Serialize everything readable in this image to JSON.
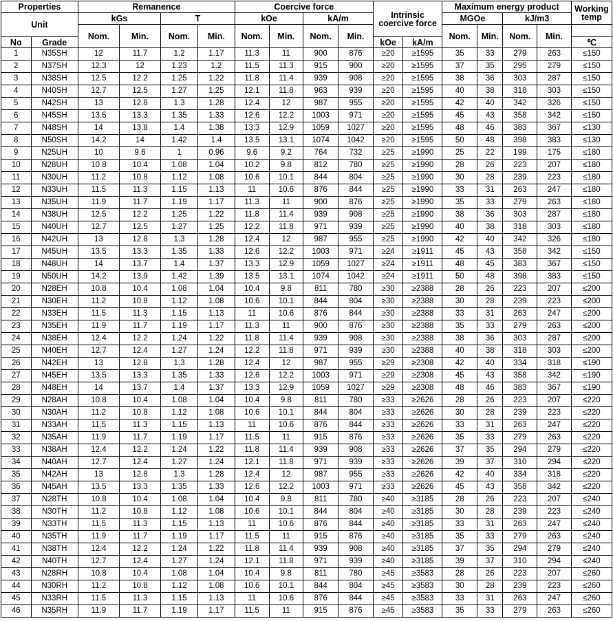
{
  "headers": {
    "properties": "Properties",
    "unit": "Unit",
    "no": "No",
    "grade": "Grade",
    "remanence": "Remanence",
    "coercive_force": "Coercive force",
    "intrinsic_coercive_force": "Intrinsic coercive force",
    "max_energy_product": "Maximum energy product",
    "working_temp": "Working temp",
    "kgs": "kGs",
    "t": "T",
    "koe": "kOe",
    "ka_m": "kA/m",
    "mgoe": "MGOe",
    "kj_m3": "kJ/m3",
    "nom": "Nom.",
    "min": "Min.",
    "celsius": "℃"
  },
  "rows": [
    [
      "1",
      "N35SH",
      "12",
      "11.7",
      "1.2",
      "1.17",
      "11.3",
      "11",
      "900",
      "876",
      "≥20",
      "≥1595",
      "35",
      "33",
      "279",
      "263",
      "≤150"
    ],
    [
      "2",
      "N37SH",
      "12.3",
      "12",
      "1.23",
      "1.2",
      "11.5",
      "11.3",
      "915",
      "900",
      "≥20",
      "≥1595",
      "37",
      "35",
      "295",
      "279",
      "≤150"
    ],
    [
      "3",
      "N38SH",
      "12.5",
      "12.2",
      "1.25",
      "1.22",
      "11.8",
      "11.4",
      "939",
      "908",
      "≥20",
      "≥1595",
      "38",
      "36",
      "303",
      "287",
      "≤150"
    ],
    [
      "4",
      "N40SH",
      "12.7",
      "12.5",
      "1.27",
      "1.25",
      "12.1",
      "11.8",
      "963",
      "939",
      "≥20",
      "≥1595",
      "40",
      "38",
      "318",
      "303",
      "≤150"
    ],
    [
      "5",
      "N42SH",
      "13",
      "12.8",
      "1.3",
      "1.28",
      "12.4",
      "12",
      "987",
      "955",
      "≥20",
      "≥1595",
      "42",
      "40",
      "342",
      "326",
      "≤150"
    ],
    [
      "6",
      "N45SH",
      "13.5",
      "13.3",
      "1.35",
      "1.33",
      "12.6",
      "12.2",
      "1003",
      "971",
      "≥20",
      "≥1595",
      "45",
      "43",
      "358",
      "342",
      "≤150"
    ],
    [
      "7",
      "N48SH",
      "14",
      "13.8",
      "1.4",
      "1.38",
      "13.3",
      "12.9",
      "1059",
      "1027",
      "≥20",
      "≥1595",
      "48",
      "46",
      "383",
      "367",
      "≤130"
    ],
    [
      "8",
      "N50SH",
      "14.2",
      "14",
      "1.42",
      "1.4",
      "13.5",
      "13.1",
      "1074",
      "1042",
      "≥20",
      "≥1595",
      "50",
      "48",
      "398",
      "383",
      "≤130"
    ],
    [
      "9",
      "N25UH",
      "10",
      "9.6",
      "1",
      "0.96",
      "9.6",
      "9.2",
      "764",
      "732",
      "≥25",
      "≥1990",
      "25",
      "22",
      "199",
      "175",
      "≤180"
    ],
    [
      "10",
      "N28UH",
      "10.8",
      "10.4",
      "1.08",
      "1.04",
      "10.2",
      "9.8",
      "812",
      "780",
      "≥25",
      "≥1990",
      "28",
      "26",
      "223",
      "207",
      "≤180"
    ],
    [
      "11",
      "N30UH",
      "11.2",
      "10.8",
      "1.12",
      "1.08",
      "10.6",
      "10.1",
      "844",
      "804",
      "≥25",
      "≥1990",
      "30",
      "28",
      "239",
      "223",
      "≤180"
    ],
    [
      "12",
      "N33UH",
      "11.5",
      "11.3",
      "1.15",
      "1.13",
      "11",
      "10.6",
      "876",
      "844",
      "≥25",
      "≥1990",
      "33",
      "31",
      "263",
      "247",
      "≤180"
    ],
    [
      "13",
      "N35UH",
      "11.9",
      "11.7",
      "1.19",
      "1.17",
      "11.3",
      "11",
      "900",
      "876",
      "≥25",
      "≥1990",
      "35",
      "33",
      "279",
      "263",
      "≤180"
    ],
    [
      "14",
      "N38UH",
      "12.5",
      "12.2",
      "1.25",
      "1.22",
      "11.8",
      "11.4",
      "939",
      "908",
      "≥25",
      "≥1990",
      "38",
      "36",
      "303",
      "287",
      "≤180"
    ],
    [
      "15",
      "N40UH",
      "12.7",
      "12.5",
      "1.27",
      "1.25",
      "12.2",
      "11.8",
      "971",
      "939",
      "≥25",
      "≥1990",
      "40",
      "38",
      "318",
      "303",
      "≤180"
    ],
    [
      "16",
      "N42UH",
      "13",
      "12.8",
      "1.3",
      "1.28",
      "12.4",
      "12",
      "987",
      "955",
      "≥25",
      "≥1990",
      "42",
      "40",
      "342",
      "326",
      "≤180"
    ],
    [
      "17",
      "N45UH",
      "13.5",
      "13.3",
      "1.35",
      "1.33",
      "12.6",
      "12.2",
      "1003",
      "971",
      "≥24",
      "≥1911",
      "45",
      "43",
      "358",
      "342",
      "≤150"
    ],
    [
      "18",
      "N48UH",
      "14",
      "13.7",
      "1.4",
      "1.37",
      "13.3",
      "12.9",
      "1059",
      "1027",
      "≥24",
      "≥1911",
      "48",
      "45",
      "383",
      "367",
      "≤150"
    ],
    [
      "19",
      "N50UH",
      "14.2",
      "13.9",
      "1.42",
      "1.39",
      "13.5",
      "13.1",
      "1074",
      "1042",
      "≥24",
      "≥1911",
      "50",
      "48",
      "398",
      "383",
      "≤150"
    ],
    [
      "20",
      "N28EH",
      "10.8",
      "10.4",
      "1.08",
      "1.04",
      "10.4",
      "9.8",
      "811",
      "780",
      "≥30",
      "≥2388",
      "28",
      "26",
      "223",
      "207",
      "≤200"
    ],
    [
      "21",
      "N30EH",
      "11.2",
      "10.8",
      "1.12",
      "1.08",
      "10.6",
      "10.1",
      "844",
      "804",
      "≥30",
      "≥2388",
      "30",
      "28",
      "239",
      "223",
      "≤200"
    ],
    [
      "22",
      "N33EH",
      "11.5",
      "11.3",
      "1.15",
      "1.13",
      "11",
      "10.6",
      "876",
      "844",
      "≥30",
      "≥2388",
      "33",
      "31",
      "263",
      "247",
      "≤200"
    ],
    [
      "23",
      "N35EH",
      "11.9",
      "11.7",
      "1.19",
      "1.17",
      "11.3",
      "11",
      "900",
      "876",
      "≥30",
      "≥2388",
      "35",
      "33",
      "279",
      "263",
      "≤200"
    ],
    [
      "24",
      "N38EH",
      "12.4",
      "12.2",
      "1.24",
      "1.22",
      "11.8",
      "11.4",
      "939",
      "908",
      "≥30",
      "≥2388",
      "38",
      "36",
      "303",
      "287",
      "≤200"
    ],
    [
      "25",
      "N40EH",
      "12.7",
      "12.4",
      "1.27",
      "1.24",
      "12.2",
      "11.8",
      "971",
      "939",
      "≥30",
      "≥2388",
      "40",
      "38",
      "318",
      "303",
      "≤200"
    ],
    [
      "26",
      "N42EH",
      "13",
      "12.8",
      "1.3",
      "1.28",
      "12.4",
      "12",
      "987",
      "955",
      "≥29",
      "≥2308",
      "42",
      "40",
      "334",
      "318",
      "≤190"
    ],
    [
      "27",
      "N45EH",
      "13.5",
      "13.3",
      "1.35",
      "1.33",
      "12.6",
      "12.2",
      "1003",
      "971",
      "≥29",
      "≥2308",
      "45",
      "43",
      "358",
      "342",
      "≤190"
    ],
    [
      "28",
      "N48EH",
      "14",
      "13.7",
      "1.4",
      "1.37",
      "13.3",
      "12.9",
      "1059",
      "1027",
      "≥29",
      "≥2308",
      "48",
      "46",
      "383",
      "367",
      "≤190"
    ],
    [
      "29",
      "N28AH",
      "10.8",
      "10.4",
      "1.08",
      "1.04",
      "10.4",
      "9.8",
      "811",
      "780",
      "≥33",
      "≥2626",
      "28",
      "26",
      "223",
      "207",
      "≤220"
    ],
    [
      "30",
      "N30AH",
      "11.2",
      "10.8",
      "1.12",
      "1.08",
      "10.6",
      "10.1",
      "844",
      "804",
      "≥33",
      "≥2626",
      "30",
      "28",
      "239",
      "223",
      "≤220"
    ],
    [
      "31",
      "N33AH",
      "11.5",
      "11.3",
      "1.15",
      "1.13",
      "11",
      "10.6",
      "876",
      "844",
      "≥33",
      "≥2626",
      "33",
      "31",
      "263",
      "247",
      "≤220"
    ],
    [
      "32",
      "N35AH",
      "11.9",
      "11.7",
      "1.19",
      "1.17",
      "11.5",
      "11",
      "915",
      "876",
      "≥33",
      "≥2626",
      "35",
      "33",
      "279",
      "263",
      "≤220"
    ],
    [
      "33",
      "N38AH",
      "12.4",
      "12.2",
      "1.24",
      "1.22",
      "11.8",
      "11.4",
      "939",
      "908",
      "≥33",
      "≥2626",
      "37",
      "35",
      "294",
      "279",
      "≤220"
    ],
    [
      "34",
      "N40AH",
      "12.7",
      "12.4",
      "1.27",
      "1.24",
      "12.1",
      "11.8",
      "971",
      "939",
      "≥33",
      "≥2626",
      "39",
      "37",
      "310",
      "294",
      "≤220"
    ],
    [
      "35",
      "N42AH",
      "13",
      "12.8",
      "1.3",
      "1.28",
      "12.4",
      "12",
      "987",
      "955",
      "≥33",
      "≥2626",
      "42",
      "40",
      "334",
      "318",
      "≤220"
    ],
    [
      "36",
      "N45AH",
      "13.5",
      "13.3",
      "1.35",
      "1.33",
      "12.6",
      "12.2",
      "1003",
      "971",
      "≥33",
      "≥2626",
      "45",
      "43",
      "358",
      "342",
      "≤220"
    ],
    [
      "37",
      "N28TH",
      "10.8",
      "10.4",
      "1.08",
      "1.04",
      "10.4",
      "9.8",
      "811",
      "780",
      "≥40",
      "≥3185",
      "28",
      "26",
      "223",
      "207",
      "≤240"
    ],
    [
      "38",
      "N30TH",
      "11.2",
      "10.8",
      "1.12",
      "1.08",
      "10.6",
      "10.1",
      "844",
      "804",
      "≥40",
      "≥3185",
      "30",
      "28",
      "239",
      "223",
      "≤240"
    ],
    [
      "39",
      "N33TH",
      "11.5",
      "11.3",
      "1.15",
      "1.13",
      "11",
      "10.6",
      "876",
      "844",
      "≥40",
      "≥3185",
      "33",
      "31",
      "263",
      "247",
      "≤240"
    ],
    [
      "40",
      "N35TH",
      "11.9",
      "11.7",
      "1.19",
      "1.17",
      "11.5",
      "11",
      "915",
      "876",
      "≥40",
      "≥3185",
      "35",
      "33",
      "279",
      "263",
      "≤240"
    ],
    [
      "41",
      "N38TH",
      "12.4",
      "12.2",
      "1.24",
      "1.22",
      "11.8",
      "11.4",
      "939",
      "908",
      "≥40",
      "≥3185",
      "37",
      "35",
      "294",
      "279",
      "≤240"
    ],
    [
      "42",
      "N40TH",
      "12.7",
      "12.4",
      "1.27",
      "1.24",
      "12.1",
      "11.8",
      "971",
      "939",
      "≥40",
      "≥3185",
      "39",
      "37",
      "310",
      "294",
      "≤240"
    ],
    [
      "43",
      "N28RH",
      "10.8",
      "10.4",
      "1.08",
      "1.04",
      "10.4",
      "9.8",
      "811",
      "780",
      "≥45",
      "≥3583",
      "28",
      "26",
      "223",
      "207",
      "≤260"
    ],
    [
      "44",
      "N30RH",
      "11.2",
      "10.8",
      "1.12",
      "1.08",
      "10.6",
      "10.1",
      "844",
      "804",
      "≥45",
      "≥3583",
      "30",
      "28",
      "239",
      "223",
      "≤260"
    ],
    [
      "45",
      "N33RH",
      "11.5",
      "11.3",
      "1.15",
      "1.13",
      "11",
      "10.6",
      "876",
      "844",
      "≥45",
      "≥3583",
      "33",
      "31",
      "263",
      "247",
      "≤260"
    ],
    [
      "46",
      "N35RH",
      "11.9",
      "11.7",
      "1.19",
      "1.17",
      "11.5",
      "11",
      "915",
      "876",
      "≥45",
      "≥3583",
      "35",
      "33",
      "279",
      "263",
      "≤260"
    ]
  ]
}
